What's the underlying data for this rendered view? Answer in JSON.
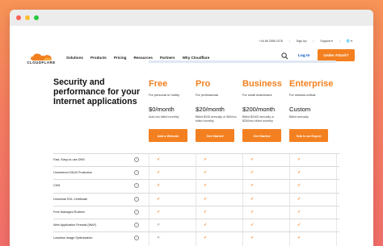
{
  "window": {
    "controls": [
      "close",
      "minimize",
      "maximize"
    ]
  },
  "topbar": {
    "phone": "+44 66 2555 2278",
    "signup": "Sign Up",
    "support": "Support ▾",
    "language": "🌐 ▾"
  },
  "navbar": {
    "logo_text": "CLOUDFLARE",
    "links": [
      "Solutions",
      "Products",
      "Pricing",
      "Resources",
      "Partners",
      "Why Cloudflare"
    ],
    "login": "Log In",
    "attack_button": "Under Attack?"
  },
  "colors": {
    "brand_orange": "#f38020",
    "link_blue": "#0051c3"
  },
  "hero": {
    "title": "Security and performance for your Internet applications"
  },
  "plans": [
    {
      "name": "Free",
      "subtitle": "For personal or hobby",
      "price": "$0/month",
      "desc": "Add-ons billed monthly",
      "button": "Add a Website"
    },
    {
      "name": "Pro",
      "subtitle": "For professional",
      "price": "$20/month",
      "desc": "Billed $240 annually or $25/mo billed monthly",
      "button": "Get Started"
    },
    {
      "name": "Business",
      "subtitle": "For small businesses",
      "price": "$200/month",
      "desc": "Billed $2400 annually or $250/mo billed monthly",
      "button": "Get Started"
    },
    {
      "name": "Enterprise",
      "subtitle": "For mission-critical",
      "price": "Custom",
      "desc": "Billed annually",
      "button": "Talk to an Expert"
    }
  ],
  "features": [
    {
      "label": "Fast, Easy-to-use DNS",
      "marks": [
        "yes",
        "yes",
        "yes",
        "yes"
      ]
    },
    {
      "label": "Unmetered DDoS Protection",
      "marks": [
        "yes",
        "yes",
        "yes",
        "yes"
      ]
    },
    {
      "label": "CDN",
      "marks": [
        "yes",
        "yes",
        "yes",
        "yes"
      ]
    },
    {
      "label": "Universal SSL Certificate",
      "marks": [
        "yes",
        "yes",
        "yes",
        "yes"
      ]
    },
    {
      "label": "Free Managed Ruleset",
      "marks": [
        "yes",
        "yes",
        "yes",
        "yes"
      ]
    },
    {
      "label": "Web Application Firewall (WAF)",
      "marks": [
        "no",
        "yes",
        "yes",
        "yes"
      ]
    },
    {
      "label": "Lossless Image Optimization",
      "marks": [
        "no",
        "yes",
        "yes",
        "yes"
      ]
    }
  ],
  "icons": {
    "check": "✓",
    "cross": "✕",
    "info": "i",
    "search": "search-icon"
  }
}
